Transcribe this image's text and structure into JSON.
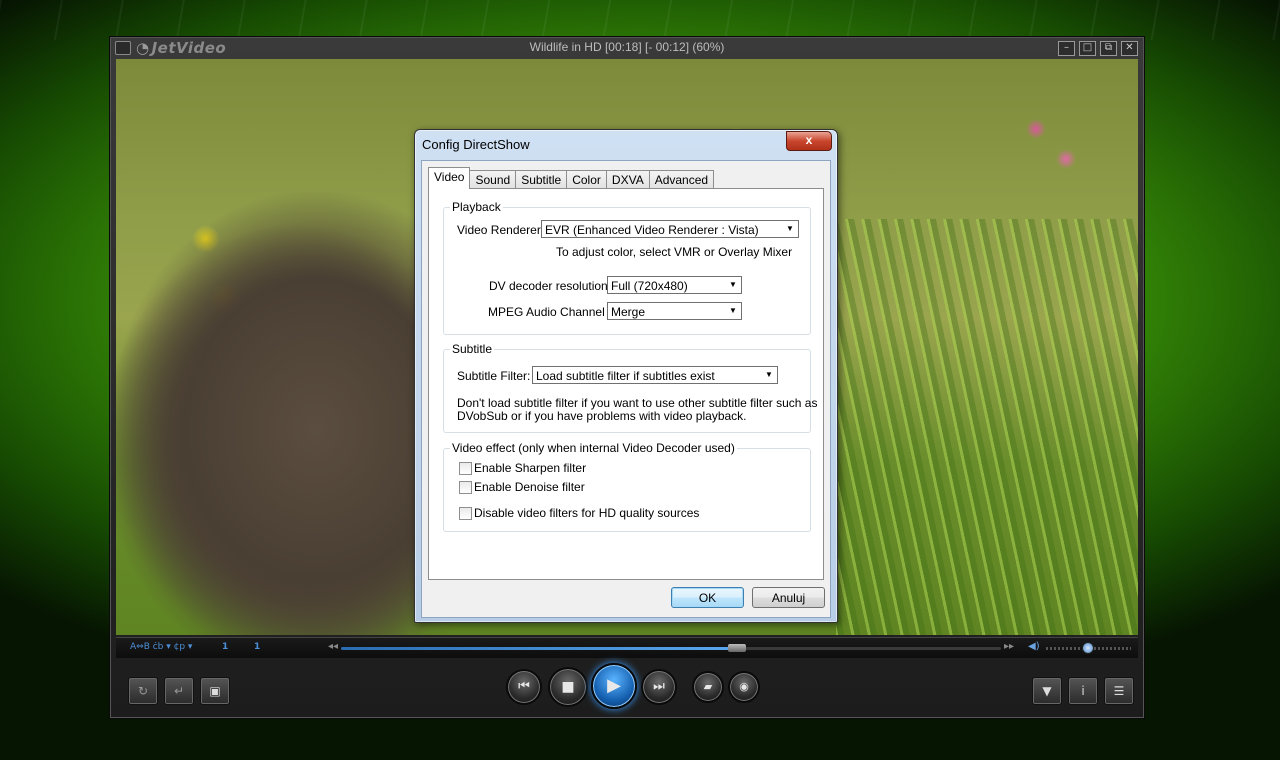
{
  "window": {
    "app_logo": "JetVideo",
    "title": "Wildlife in HD [00:18] [- 00:12] (60%)",
    "buttons": [
      "minimize",
      "maximize",
      "restore",
      "close"
    ]
  },
  "dialog": {
    "title": "Config DirectShow",
    "close_label": "x",
    "tabs": [
      {
        "label": "Video",
        "active": true
      },
      {
        "label": "Sound",
        "active": false
      },
      {
        "label": "Subtitle",
        "active": false
      },
      {
        "label": "Color",
        "active": false
      },
      {
        "label": "DXVA",
        "active": false
      },
      {
        "label": "Advanced",
        "active": false
      }
    ],
    "playback": {
      "title": "Playback",
      "video_renderer_label": "Video Renderer:",
      "video_renderer_value": "EVR (Enhanced Video Renderer : Vista)",
      "renderer_hint": "To adjust color, select VMR or Overlay Mixer",
      "dv_label": "DV decoder resolution:",
      "dv_value": "Full (720x480)",
      "mpeg_label": "MPEG Audio Channel :",
      "mpeg_value": "Merge"
    },
    "subtitle": {
      "title": "Subtitle",
      "filter_label": "Subtitle Filter:",
      "filter_value": "Load subtitle filter if subtitles exist",
      "hint_line1": "Don't load subtitle filter if you want to use other subtitle filter such as",
      "hint_line2": "DVobSub or if you have problems with video playback."
    },
    "video_effect": {
      "title": "Video effect (only when internal Video Decoder used)",
      "sharpen_label": "Enable Sharpen filter",
      "sharpen_checked": false,
      "denoise_label": "Enable Denoise filter",
      "denoise_checked": false,
      "disable_hd_label": "Disable video filters for HD quality sources",
      "disable_hd_checked": false
    },
    "ok_label": "OK",
    "cancel_label": "Anuluj"
  },
  "seekbar": {
    "audio_track_text": "A⇔B ċb ▾ ¢p ▾",
    "counter_1": "1",
    "counter_2": "1",
    "progress_fraction": 0.6,
    "volume_fraction": 0.48
  },
  "colors": {
    "accent_blue": "#3a9bff",
    "dialog_frame": "#b7cde6",
    "close_red": "#c9462d"
  },
  "icons": {
    "left_buttons": [
      "repeat-icon",
      "chapter-icon",
      "snapshot-icon"
    ],
    "transport": [
      "previous-icon",
      "stop-icon",
      "play-icon",
      "next-icon"
    ],
    "extra": [
      "open-file-icon",
      "disc-icon"
    ],
    "right_buttons": [
      "eject-menu-icon",
      "info-icon",
      "playlist-icon"
    ]
  }
}
